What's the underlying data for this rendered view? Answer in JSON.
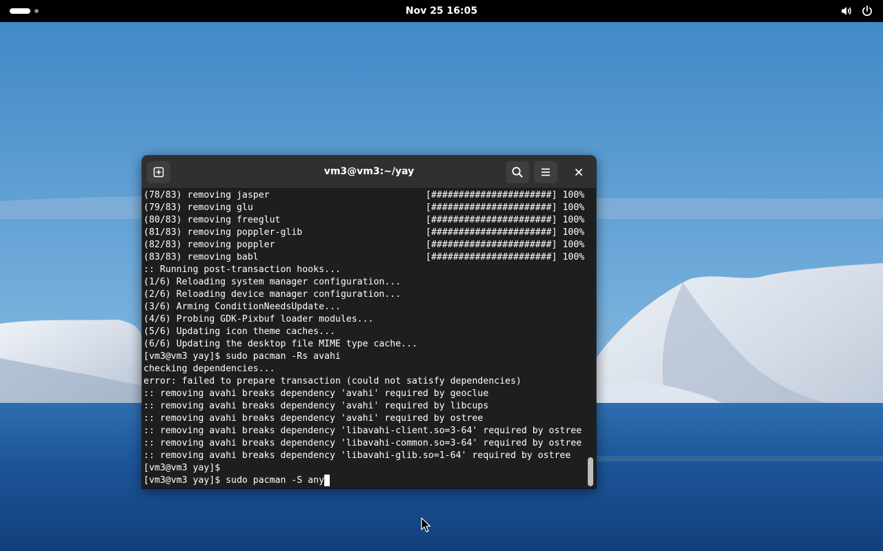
{
  "topbar": {
    "clock": "Nov 25  16:05",
    "icons": [
      "activities-indicator",
      "volume-icon",
      "power-icon"
    ]
  },
  "terminal": {
    "title": "vm3@vm3:~/yay",
    "icons": [
      "new-tab-icon",
      "search-icon",
      "hamburger-menu-icon",
      "close-icon"
    ],
    "lines": [
      {
        "text": "(78/83) removing jasper",
        "progress": "[######################] 100%"
      },
      {
        "text": "(79/83) removing glu",
        "progress": "[######################] 100%"
      },
      {
        "text": "(80/83) removing freeglut",
        "progress": "[######################] 100%"
      },
      {
        "text": "(81/83) removing poppler-glib",
        "progress": "[######################] 100%"
      },
      {
        "text": "(82/83) removing poppler",
        "progress": "[######################] 100%"
      },
      {
        "text": "(83/83) removing babl",
        "progress": "[######################] 100%"
      },
      {
        "text": ":: Running post-transaction hooks..."
      },
      {
        "text": "(1/6) Reloading system manager configuration..."
      },
      {
        "text": "(2/6) Reloading device manager configuration..."
      },
      {
        "text": "(3/6) Arming ConditionNeedsUpdate..."
      },
      {
        "text": "(4/6) Probing GDK-Pixbuf loader modules..."
      },
      {
        "text": "(5/6) Updating icon theme caches..."
      },
      {
        "text": "(6/6) Updating the desktop file MIME type cache..."
      },
      {
        "text": "[vm3@vm3 yay]$ sudo pacman -Rs avahi"
      },
      {
        "text": "checking dependencies..."
      },
      {
        "text": "error: failed to prepare transaction (could not satisfy dependencies)"
      },
      {
        "text": ":: removing avahi breaks dependency 'avahi' required by geoclue"
      },
      {
        "text": ":: removing avahi breaks dependency 'avahi' required by libcups"
      },
      {
        "text": ":: removing avahi breaks dependency 'avahi' required by ostree"
      },
      {
        "text": ":: removing avahi breaks dependency 'libavahi-client.so=3-64' required by ostree"
      },
      {
        "text": ":: removing avahi breaks dependency 'libavahi-common.so=3-64' required by ostree"
      },
      {
        "text": ":: removing avahi breaks dependency 'libavahi-glib.so=1-64' required by ostree"
      },
      {
        "text": "[vm3@vm3 yay]$"
      }
    ],
    "prompt": "[vm3@vm3 yay]$ ",
    "current_input": "sudo pacman -S any"
  },
  "colors": {
    "topbar_bg": "#000000",
    "terminal_bg": "#1e1e1e",
    "headerbar_bg": "#303030",
    "terminal_fg": "#ffffff"
  }
}
